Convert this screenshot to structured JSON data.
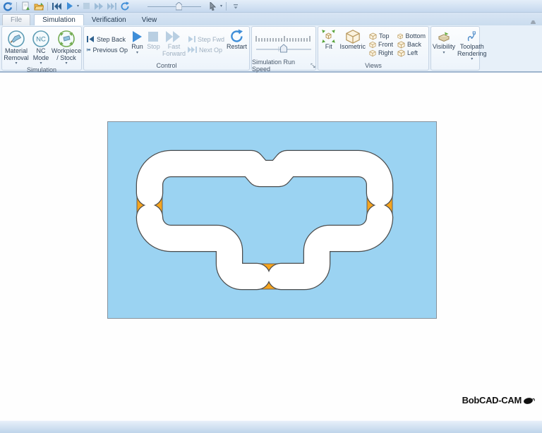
{
  "tabs": {
    "file": "File",
    "simulation": "Simulation",
    "verification": "Verification",
    "view": "View"
  },
  "ribbon": {
    "simulation_group": {
      "label": "Simulation",
      "material_removal": "Material Removal",
      "nc_mode": "NC Mode",
      "workpiece_stock": "Workpiece / Stock"
    },
    "control_group": {
      "label": "Control",
      "step_back": "Step Back",
      "previous_op": "Previous Op",
      "run": "Run",
      "stop": "Stop",
      "fast_forward": "Fast Forward",
      "step_fwd": "Step Fwd",
      "next_op": "Next Op",
      "restart": "Restart"
    },
    "speed_group": {
      "label": "Simulation Run Speed"
    },
    "views_group": {
      "label": "Views",
      "fit": "Fit",
      "isometric": "Isometric",
      "top": "Top",
      "front": "Front",
      "right": "Right",
      "bottom": "Bottom",
      "back": "Back",
      "left": "Left"
    },
    "render_group": {
      "visibility": "Visibility",
      "toolpath_rendering": "Toolpath Rendering"
    }
  },
  "canvas": {
    "stock_color": "#9bd3f2",
    "stock_border_color": "#87929c",
    "tab_color": "#f6a41e",
    "pocket_color": "#ffffff",
    "outline_color": "#4d4d4d"
  },
  "branding": {
    "logo": "BobCAD-CAM"
  },
  "icons": {
    "caret": "▾",
    "nc": "NC"
  }
}
